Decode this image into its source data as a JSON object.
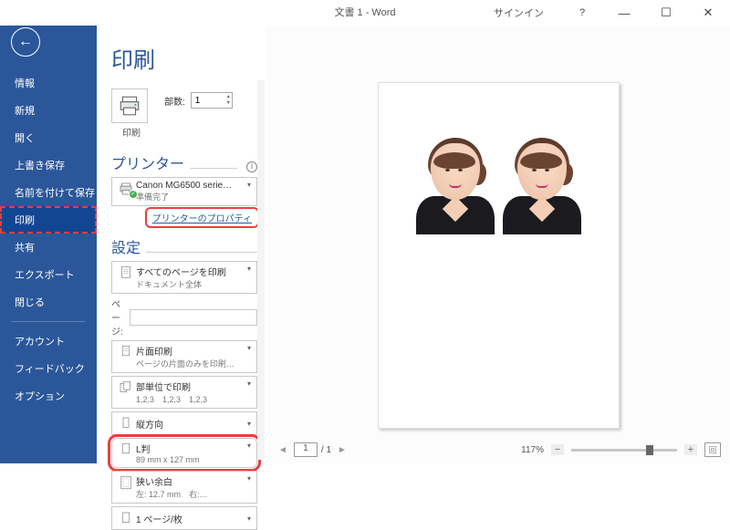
{
  "titlebar": {
    "title": "文書 1 - Word",
    "signin": "サインイン",
    "help": "?",
    "min": "—",
    "max": "☐",
    "close": "✕"
  },
  "sidebar": {
    "items": [
      "情報",
      "新規",
      "開く",
      "上書き保存",
      "名前を付けて保存",
      "印刷",
      "共有",
      "エクスポート",
      "閉じる"
    ],
    "items2": [
      "アカウント",
      "フィードバック",
      "オプション"
    ],
    "selectedIndex": 5
  },
  "page": {
    "title": "印刷"
  },
  "print": {
    "button_label": "印刷",
    "copies_label": "部数:",
    "copies_value": "1"
  },
  "printer": {
    "section": "プリンター",
    "name": "Canon MG6500 serie…",
    "status": "準備完了",
    "properties_link": "プリンターのプロパティ"
  },
  "settings": {
    "section": "設定",
    "pagesPrint": {
      "line1": "すべてのページを印刷",
      "line2": "ドキュメント全体"
    },
    "pages_label": "ページ:",
    "pages_value": "",
    "duplex": {
      "line1": "片面印刷",
      "line2": "ページの片面のみを印刷…"
    },
    "collate": {
      "line1": "部単位で印刷",
      "line2": "1,2,3　1,2,3　1,2,3"
    },
    "orientation": {
      "line1": "縦方向"
    },
    "paper": {
      "line1": "L判",
      "line2": "89 mm x 127 mm"
    },
    "margins": {
      "line1": "狭い余白",
      "line2": "左: 12.7 mm　右:…"
    },
    "perSheet": {
      "line1": "1 ページ/枚"
    }
  },
  "preview": {
    "page_current": "1",
    "page_total": "/ 1",
    "zoom": "117%",
    "minus": "−",
    "plus": "+"
  }
}
